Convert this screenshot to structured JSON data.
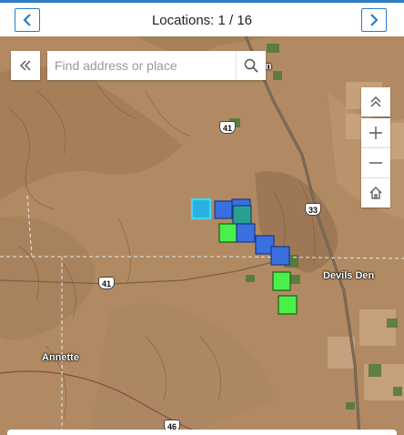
{
  "header": {
    "title": "Locations: 1 / 16",
    "prev_icon": "chevron-left-icon",
    "next_icon": "chevron-right-icon"
  },
  "search": {
    "placeholder": "Find address or place"
  },
  "map_controls": [
    "collapse-up-icon",
    "zoom-in-icon",
    "zoom-out-icon",
    "home-icon"
  ],
  "places": {
    "devils_den": "Devils Den",
    "annette": "Annette",
    "partial_label": "on"
  },
  "routes": {
    "r41_north": "41",
    "r33": "33",
    "r41_west": "41",
    "r46": "46"
  },
  "colors": {
    "accent": "#2b7bc4",
    "selected": "#3fd8f0",
    "blue_marker": "#3a6fe0",
    "green_marker": "#4af04a"
  }
}
